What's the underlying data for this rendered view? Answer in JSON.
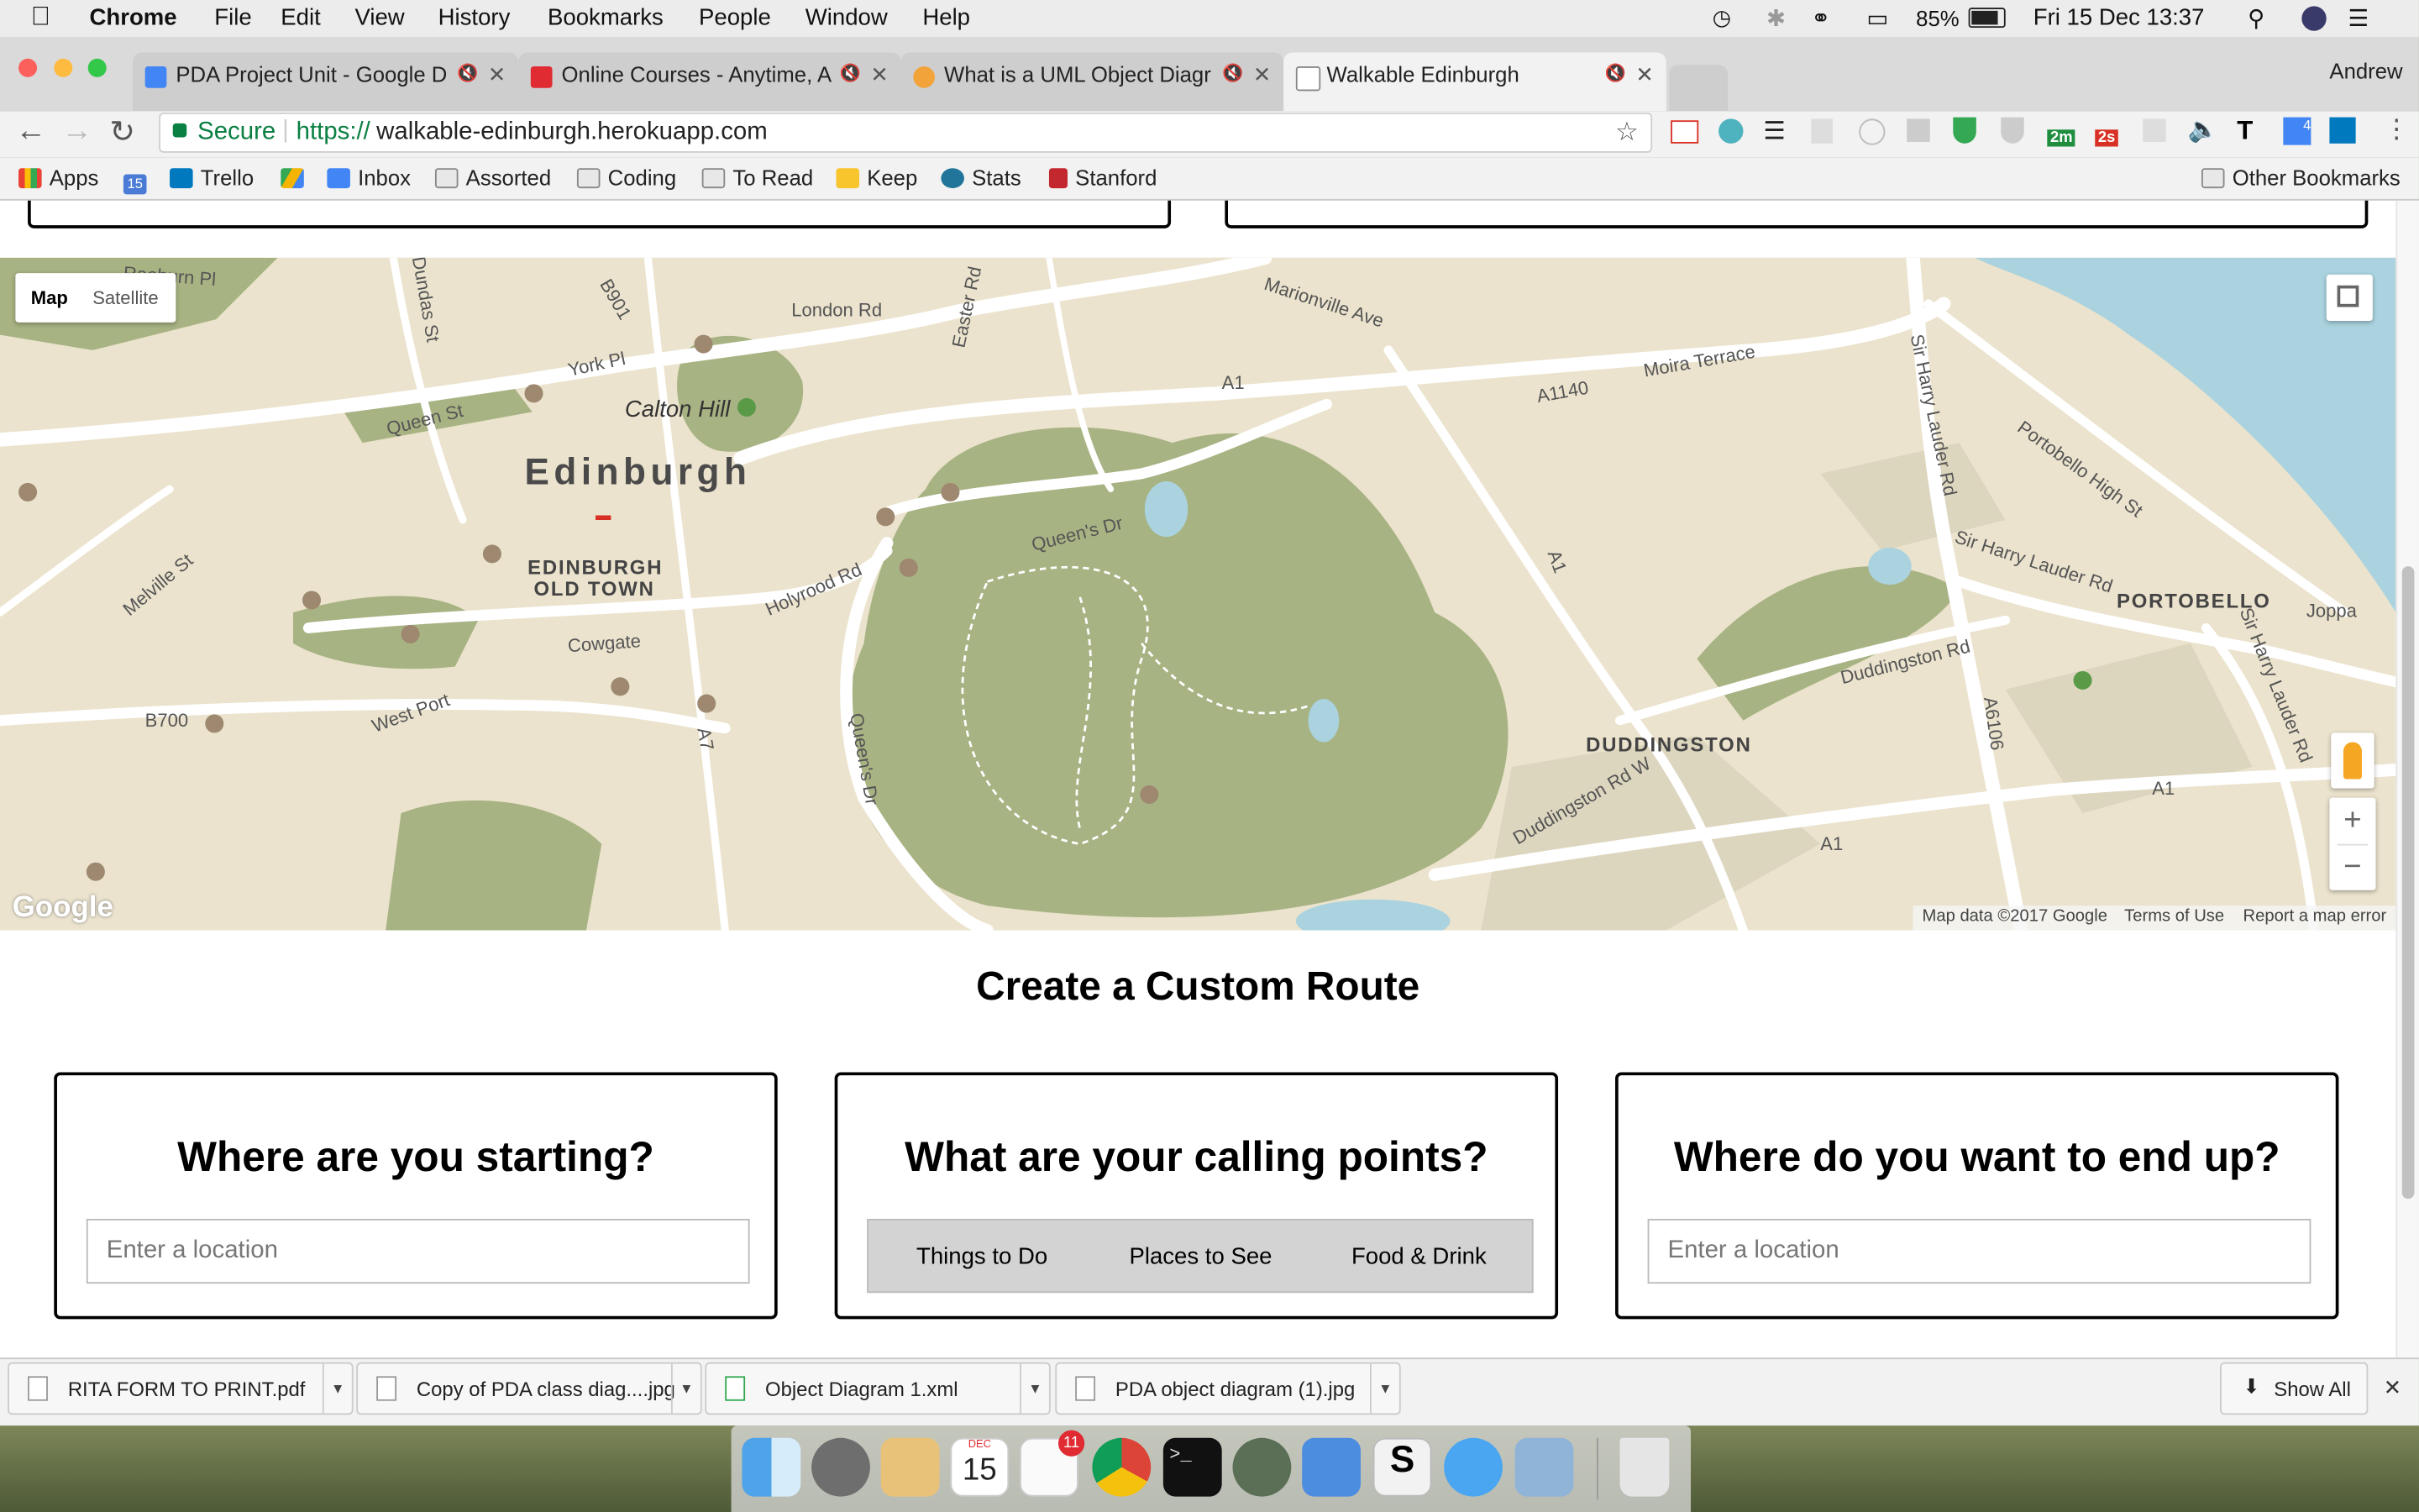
{
  "menubar": {
    "app": "Chrome",
    "items": [
      "File",
      "Edit",
      "View",
      "History",
      "Bookmarks",
      "People",
      "Window",
      "Help"
    ],
    "battery": "85%",
    "clock": "Fri 15 Dec  13:37"
  },
  "tabs": [
    {
      "title": "PDA Project Unit - Google D",
      "color": "#4285f4"
    },
    {
      "title": "Online Courses - Anytime, A",
      "color": "#e02b33"
    },
    {
      "title": "What is a UML Object Diagr",
      "color": "#f2a33a"
    },
    {
      "title": "Walkable Edinburgh",
      "color": "#ffffff"
    }
  ],
  "profile": "Andrew",
  "omnibox": {
    "secure": "Secure",
    "url_scheme": "https://",
    "url_host": "walkable-edinburgh.herokuapp.com"
  },
  "bookmarks": {
    "items": [
      {
        "label": "Apps",
        "color": "#e94235"
      },
      {
        "label": "15",
        "color": "#4a7bd6"
      },
      {
        "label": "Trello",
        "color": "#0079bf"
      },
      {
        "label": "",
        "color": "#f4b400"
      },
      {
        "label": "Inbox",
        "color": "#4285f4"
      },
      {
        "label": "Assorted",
        "color": "folder"
      },
      {
        "label": "Coding",
        "color": "folder"
      },
      {
        "label": "To Read",
        "color": "folder"
      },
      {
        "label": "Keep",
        "color": "#f8c52c"
      },
      {
        "label": "Stats",
        "color": "#21759b"
      },
      {
        "label": "Stanford",
        "color": "#c4282f"
      }
    ],
    "other": "Other Bookmarks"
  },
  "extensions": {
    "badge_1": "2m",
    "badge_2": "2s",
    "badge_3": "4"
  },
  "map": {
    "type_map": "Map",
    "type_satellite": "Satellite",
    "attribution": "Map data ©2017 Google",
    "terms": "Terms of Use",
    "report": "Report a map error",
    "logo": "Google",
    "zoom_in": "+",
    "zoom_out": "−",
    "labels": {
      "city": "Edinburgh",
      "old_town_1": "EDINBURGH",
      "old_town_2": "OLD TOWN",
      "calton": "Calton Hill",
      "queen_st": "Queen St",
      "york_pl": "York Pl",
      "london_rd": "London Rd",
      "easter_rd": "Easter Rd",
      "marionville": "Marionville Ave",
      "moira": "Moira Terrace",
      "a1": "A1",
      "a1140": "A1140",
      "queens_dr": "Queen's Dr",
      "queens_dr_2": "Queen's Dr",
      "holyrood": "Holyrood Rd",
      "cowgate": "Cowgate",
      "west_port": "West Port",
      "melville": "Melville St",
      "b700": "B700",
      "a7": "A7",
      "b901": "B901",
      "dundas": "Dundas St",
      "raeburn": "Raeburn Pl",
      "portobello_high": "Portobello High St",
      "portobello": "PORTOBELLO",
      "sir_harry_1": "Sir Harry Lauder Rd",
      "sir_harry_2": "Sir Harry Lauder Rd",
      "sir_harry_3": "Sir Harry Lauder Rd",
      "duddingston_rd": "Duddingston Rd",
      "duddingston": "DUDDINGSTON",
      "duddingston_w": "Duddingston Rd W",
      "a6106": "A6106",
      "a1_east": "A1",
      "a1_south": "A1",
      "a1_mid": "A1",
      "joppa": "Joppa"
    }
  },
  "main": {
    "heading": "Create a Custom Route",
    "start": {
      "title": "Where are you starting?",
      "placeholder": "Enter a location"
    },
    "calling": {
      "title": "What are your calling points?",
      "options": [
        "Things to Do",
        "Places to See",
        "Food & Drink"
      ]
    },
    "end": {
      "title": "Where do you want to end up?",
      "placeholder": "Enter a location"
    }
  },
  "downloads": {
    "files": [
      "RITA FORM TO PRINT.pdf",
      "Copy of PDA class diag....jpg",
      "Object Diagram 1.xml",
      "PDA object diagram (1).jpg"
    ],
    "show_all": "Show All"
  },
  "dock": {
    "calendar_day": "15",
    "calendar_month": "DEC",
    "reminders_badge": "11"
  }
}
